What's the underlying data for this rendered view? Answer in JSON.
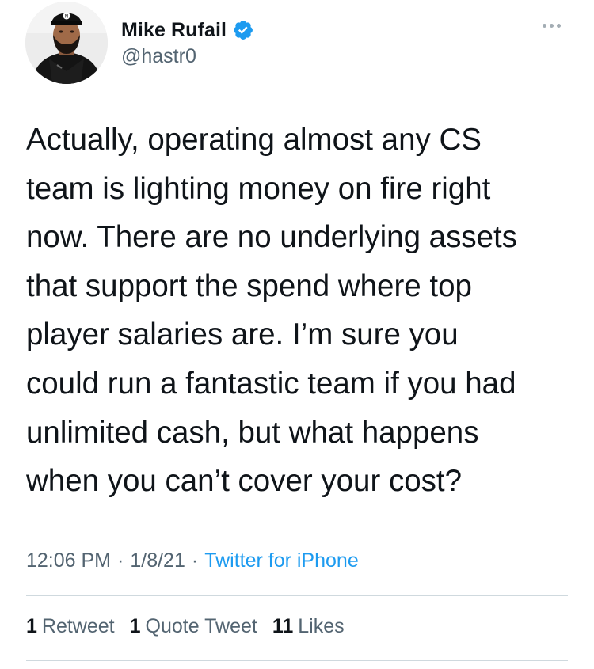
{
  "author": {
    "display_name": "Mike Rufail",
    "handle": "@hastr0",
    "verified": true,
    "avatar_icon": "profile-photo",
    "verified_icon": "verified-badge-icon"
  },
  "menu_icon": "more-options-icon",
  "tweet": {
    "text": "Actually, operating almost any CS\nteam is lighting money on fire right\nnow. There are no underlying assets\nthat support the spend where top\nplayer salaries are. I’m sure you\ncould run a fantastic team if you had\nunlimited cash, but what happens\nwhen you can’t cover your cost?"
  },
  "meta": {
    "time": "12:06 PM",
    "separator": "·",
    "date": "1/8/21",
    "source": "Twitter for iPhone"
  },
  "stats": {
    "retweets": {
      "count": "1",
      "label": "Retweet"
    },
    "quote_tweets": {
      "count": "1",
      "label": "Quote Tweet"
    },
    "likes": {
      "count": "11",
      "label": "Likes"
    }
  },
  "colors": {
    "text": "#0f1419",
    "secondary": "#536471",
    "link": "#1d9bf0",
    "verified": "#1d9bf0",
    "divider": "#cfd9de"
  }
}
